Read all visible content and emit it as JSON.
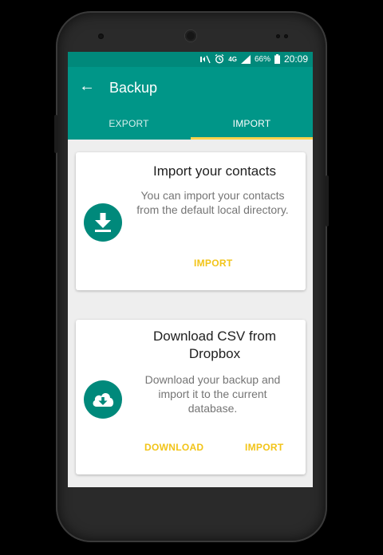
{
  "status_bar": {
    "network": "4G",
    "battery": "66%",
    "time": "20:09"
  },
  "toolbar": {
    "title": "Backup",
    "back_icon": "arrow-left-icon"
  },
  "tabs": [
    {
      "label": "EXPORT",
      "selected": false
    },
    {
      "label": "IMPORT",
      "selected": true
    }
  ],
  "cards": [
    {
      "title": "Import your contacts",
      "body": "You can import your contacts from the default local directory.",
      "icon": "download-icon",
      "actions": [
        "IMPORT"
      ]
    },
    {
      "title": "Download CSV from Dropbox",
      "body": "Download your backup and import it to the current database.",
      "icon": "cloud-download-icon",
      "actions": [
        "DOWNLOAD",
        "IMPORT"
      ]
    }
  ],
  "colors": {
    "primary": "#009688",
    "primary_dark": "#00897b",
    "accent": "#f2c419",
    "background": "#eeeeee"
  }
}
